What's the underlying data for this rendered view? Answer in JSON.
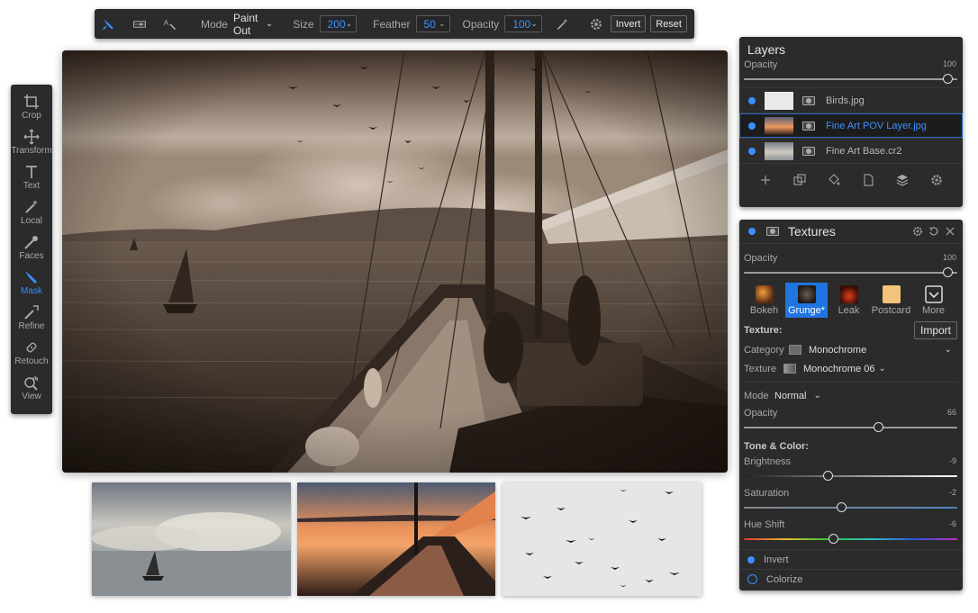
{
  "toolbar": {
    "mode_label": "Mode",
    "mode_value": "Paint Out",
    "size_label": "Size",
    "size_value": "200",
    "feather_label": "Feather",
    "feather_value": "50",
    "opacity_label": "Opacity",
    "opacity_value": "100",
    "invert_label": "Invert",
    "reset_label": "Reset"
  },
  "left_tools": [
    {
      "label": "Crop",
      "icon": "crop-icon"
    },
    {
      "label": "Transform",
      "icon": "transform-icon"
    },
    {
      "label": "Text",
      "icon": "text-icon"
    },
    {
      "label": "Local",
      "icon": "local-brush-icon"
    },
    {
      "label": "Faces",
      "icon": "faces-icon"
    },
    {
      "label": "Mask",
      "icon": "mask-brush-icon",
      "active": true
    },
    {
      "label": "Refine",
      "icon": "refine-brush-icon"
    },
    {
      "label": "Retouch",
      "icon": "retouch-icon"
    },
    {
      "label": "View",
      "icon": "view-hand-icon"
    }
  ],
  "layers_panel": {
    "title": "Layers",
    "opacity_label": "Opacity",
    "opacity_value": "100",
    "opacity_level": 1.0,
    "layers": [
      {
        "name": "Birds.jpg",
        "selected": false
      },
      {
        "name": "Fine Art POV Layer.jpg",
        "selected": true
      },
      {
        "name": "Fine Art Base.cr2",
        "selected": false
      }
    ]
  },
  "textures_panel": {
    "title": "Textures",
    "opacity_label": "Opacity",
    "opacity_value": "100",
    "opacity_level": 1.0,
    "categories": [
      {
        "label": "Bokeh",
        "selected": false
      },
      {
        "label": "Grunge*",
        "selected": true
      },
      {
        "label": "Leak",
        "selected": false
      },
      {
        "label": "Postcard",
        "selected": false
      },
      {
        "label": "More",
        "selected": false
      }
    ],
    "texture_heading": "Texture:",
    "import_label": "Import",
    "category_label": "Category",
    "category_value": "Monochrome",
    "texture_label": "Texture",
    "texture_value": "Monochrome 06",
    "mode_label": "Mode",
    "mode_value": "Normal",
    "opacity2_label": "Opacity",
    "opacity2_value": "66",
    "opacity2_level": 0.66,
    "tone_heading": "Tone & Color:",
    "brightness_label": "Brightness",
    "brightness_value": "-9",
    "brightness_level": 0.41,
    "saturation_label": "Saturation",
    "saturation_value": "-2",
    "saturation_level": 0.48,
    "hue_label": "Hue Shift",
    "hue_value": "-6",
    "hue_level": 0.44,
    "invert_label": "Invert",
    "colorize_label": "Colorize"
  },
  "colors": {
    "accent": "#3b8fff",
    "panel": "#2b2b2b"
  }
}
